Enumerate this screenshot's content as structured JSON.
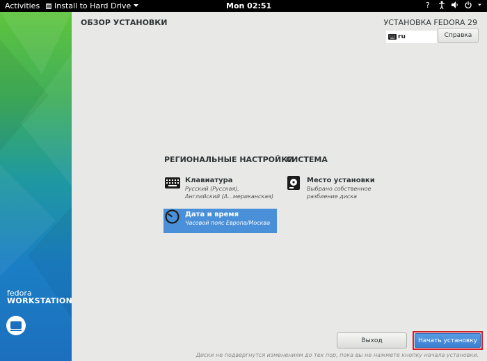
{
  "topbar": {
    "activities": "Activities",
    "app_name": "Install to Hard Drive",
    "clock": "Mon 02:51",
    "tray_icons": [
      "question-icon",
      "accessibility-icon",
      "volume-icon",
      "power-icon",
      "chevron-down-icon"
    ]
  },
  "sidebar": {
    "brand_line1": "fedora",
    "brand_line2": "WORKSTATION",
    "logo_icon": "fedora-logo-icon"
  },
  "header": {
    "title": "ОБЗОР УСТАНОВКИ",
    "product": "УСТАНОВКА FEDORA 29",
    "keyboard_layout": "ru",
    "help_button": "Справка"
  },
  "hub": {
    "localization": {
      "heading": "РЕГИОНАЛЬНЫЕ НАСТРОЙКИ",
      "keyboard": {
        "title": "Клавиатура",
        "status_line1": "Русский (Русская),",
        "status_line2": "Английский (А...мериканская)"
      },
      "datetime": {
        "title": "Дата и время",
        "status": "Часовой пояс Европа/Москва"
      }
    },
    "system": {
      "heading": "СИСТЕМА",
      "storage": {
        "title": "Место установки",
        "status_line1": "Выбрано собственное",
        "status_line2": "разбиение диска"
      }
    }
  },
  "footer": {
    "quit_button": "Выход",
    "begin_button": "Начать установку",
    "note": "Диски не подвергнутся изменениям до тех пор, пока вы не нажмете кнопку начала установки."
  },
  "colors": {
    "selected_spoke": "#4a90d9",
    "begin_button": "#3b7fd0",
    "highlight_border": "#d11f2a"
  }
}
